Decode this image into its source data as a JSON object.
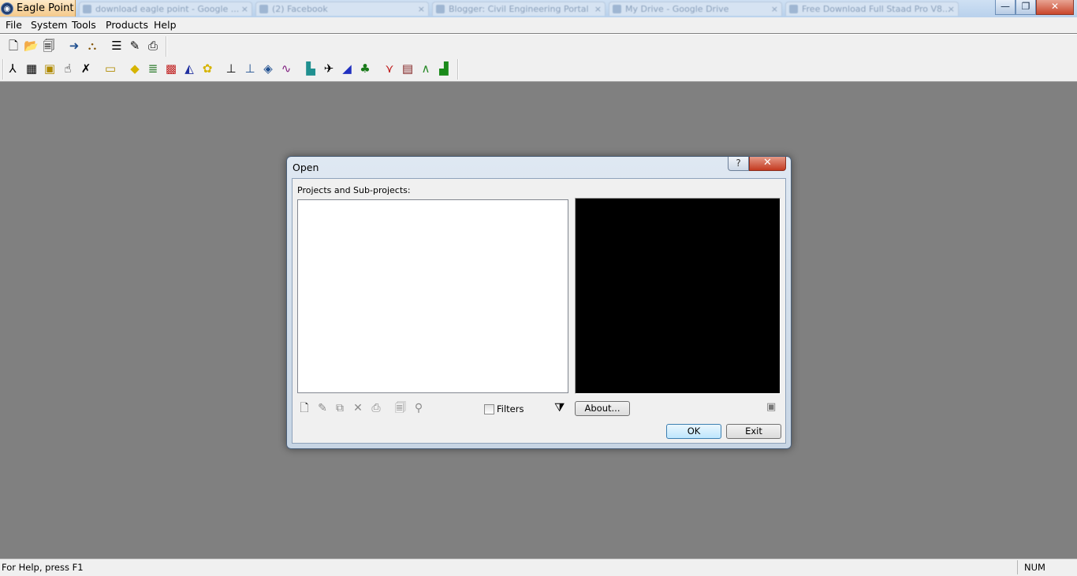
{
  "app": {
    "title": "Eagle Point",
    "logo_glyph": "◉"
  },
  "browser_tabs": [
    {
      "label": "download eagle point - Google ..."
    },
    {
      "label": "(2) Facebook"
    },
    {
      "label": "Blogger: Civil Engineering Portal"
    },
    {
      "label": "My Drive - Google Drive"
    },
    {
      "label": "Free Download Full Staad Pro V8..."
    }
  ],
  "window_controls": {
    "minimize": "—",
    "restore": "❐",
    "close": "✕"
  },
  "menu": [
    "File",
    "System",
    "Tools",
    "Products",
    "Help"
  ],
  "toolbar1": [
    {
      "icon": "new-document-icon",
      "glyph": "🗋"
    },
    {
      "icon": "open-folder-icon",
      "glyph": "📂"
    },
    {
      "icon": "properties-icon",
      "glyph": "🗐"
    },
    {
      "icon": "arrow-icon",
      "glyph": "➜"
    },
    {
      "icon": "tree-icon",
      "glyph": "⛬"
    },
    {
      "icon": "layers-icon",
      "glyph": "☰"
    },
    {
      "icon": "edit-icon",
      "glyph": "✎"
    },
    {
      "icon": "print-icon",
      "glyph": "⎙"
    }
  ],
  "toolbar2": [
    {
      "icon": "survey-icon",
      "glyph": "⅄",
      "color": "#000"
    },
    {
      "icon": "calculator-icon",
      "glyph": "▦",
      "color": "#000"
    },
    {
      "icon": "cogo-icon",
      "glyph": "▣",
      "color": "#b08a00"
    },
    {
      "icon": "hand-icon",
      "glyph": "☝",
      "color": "#000"
    },
    {
      "icon": "cross-icon",
      "glyph": "✗",
      "color": "#000"
    },
    {
      "icon": "tag-icon",
      "glyph": "▭",
      "color": "#b08a00"
    },
    {
      "icon": "road-sign-icon",
      "glyph": "◆",
      "color": "#d6b400"
    },
    {
      "icon": "stack-icon",
      "glyph": "≣",
      "color": "#2a7a2a"
    },
    {
      "icon": "grid-icon",
      "glyph": "▩",
      "color": "#c02020"
    },
    {
      "icon": "terrain-icon",
      "glyph": "◭",
      "color": "#2030a0"
    },
    {
      "icon": "network-icon",
      "glyph": "✿",
      "color": "#d6b400"
    },
    {
      "icon": "structure-icon",
      "glyph": "⊥",
      "color": "#000"
    },
    {
      "icon": "bridge-icon",
      "glyph": "⊥",
      "color": "#205090"
    },
    {
      "icon": "bridge2-icon",
      "glyph": "◈",
      "color": "#205090"
    },
    {
      "icon": "graph-icon",
      "glyph": "∿",
      "color": "#802080"
    },
    {
      "icon": "building-icon",
      "glyph": "▙",
      "color": "#209090"
    },
    {
      "icon": "plan-icon",
      "glyph": "✈",
      "color": "#000"
    },
    {
      "icon": "pipe-icon",
      "glyph": "◢",
      "color": "#2030c0"
    },
    {
      "icon": "landscape-tree-icon",
      "glyph": "♣",
      "color": "#1a7a1a"
    },
    {
      "icon": "profile-icon",
      "glyph": "⋎",
      "color": "#c02020"
    },
    {
      "icon": "section-icon",
      "glyph": "▤",
      "color": "#802020"
    },
    {
      "icon": "curve-icon",
      "glyph": "∧",
      "color": "#2a8a2a"
    },
    {
      "icon": "site-icon",
      "glyph": "▟",
      "color": "#1a8a1a"
    }
  ],
  "dialog": {
    "title": "Open",
    "help_glyph": "?",
    "close_glyph": "✕",
    "projects_label": "Projects and Sub-projects:",
    "small_toolbar": [
      {
        "icon": "new-project-icon",
        "glyph": "🗋"
      },
      {
        "icon": "edit-project-icon",
        "glyph": "✎"
      },
      {
        "icon": "copy-project-icon",
        "glyph": "⧉"
      },
      {
        "icon": "delete-project-icon",
        "glyph": "✕"
      },
      {
        "icon": "print-project-icon",
        "glyph": "⎙"
      },
      {
        "icon": "project-properties-icon",
        "glyph": "🗐"
      },
      {
        "icon": "project-wand-icon",
        "glyph": "⚲"
      }
    ],
    "filters_label": "Filters",
    "filter_glyph": "⧩",
    "about_label": "About...",
    "ok_label": "OK",
    "exit_label": "Exit",
    "camera_glyph": "▣"
  },
  "statusbar": {
    "help_text": "For Help, press F1",
    "num": "NUM"
  }
}
